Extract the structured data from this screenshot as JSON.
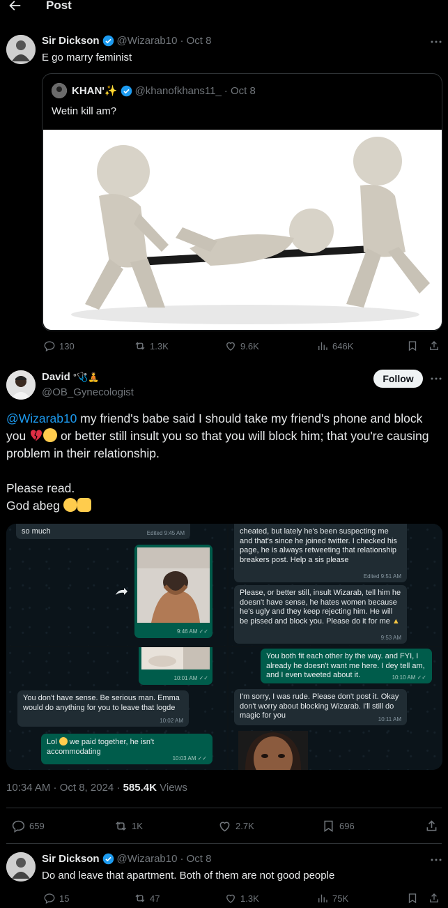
{
  "header": {
    "title": "Post"
  },
  "original_post": {
    "author_name": "Sir Dickson",
    "handle": "@Wizarab10",
    "date": "· Oct 8",
    "text": "E go marry feminist",
    "quote": {
      "author_name": "KHAN'✨",
      "handle": "@khanofkhans11_",
      "date": "· Oct 8",
      "text": "Wetin kill am?"
    },
    "stats": {
      "replies": "130",
      "reposts": "1.3K",
      "likes": "9.6K",
      "views": "646K"
    }
  },
  "main_post": {
    "author_name": "David",
    "author_emoji": "°🩺🧘",
    "handle": "@OB_Gynecologist",
    "follow_label": "Follow",
    "mention": "@Wizarab10",
    "text_part1": " my friend's babe said I should take my friend's phone and block you ",
    "text_part2": " or better still insult you so that you will block him; that you're causing problem in their relationship.",
    "line2": "Please read.",
    "line3": "God abeg",
    "timestamp": "10:34 AM · Oct 8, 2024 · ",
    "views_count": "585.4K",
    "views_label": " Views",
    "stats": {
      "replies": "659",
      "reposts": "1K",
      "likes": "2.7K",
      "bookmarks": "696"
    }
  },
  "chat": {
    "c1": {
      "text": "so much",
      "time": "Edited 9:45 AM"
    },
    "c2": {
      "time": "9:46 AM ✓✓"
    },
    "c3": {
      "text": "cheated, but lately he's been suspecting me and that's since he joined twitter. I checked his page, he is always retweeting that relationship breakers post. Help a sis please",
      "time": "Edited 9:51 AM"
    },
    "c4": {
      "text": "Please, or better still, insult Wizarab, tell him he doesn't have sense, he hates women because he's ugly and they keep rejecting him. He will be pissed and block you. Please do it for me",
      "time": "9:53 AM"
    },
    "c5": {
      "time": "10:01 AM ✓✓"
    },
    "c6": {
      "text": "You don't have sense. Be serious man. Emma would do anything for you to leave that logde",
      "time": "10:02 AM"
    },
    "c7": {
      "text_a": "Lol",
      "text_b": " we paid together, he isn't accommodating",
      "time": "10:03 AM ✓✓"
    },
    "c8": {
      "text": "You both fit each other by the way. and FYI, I already he doesn't want me here. I dey tell am, and I even tweeted about it.",
      "time": "10:10 AM ✓✓"
    },
    "c9": {
      "text": "I'm sorry, I was rude. Please don't post it. Okay don't worry about blocking Wizarab. I'll still do magic for you",
      "time": "10:11 AM"
    }
  },
  "reply_post": {
    "author_name": "Sir Dickson",
    "handle": "@Wizarab10",
    "date": "· Oct 8",
    "text": "Do and leave that apartment. Both of them are not good people",
    "stats": {
      "replies": "15",
      "reposts": "47",
      "likes": "1.3K",
      "views": "75K"
    }
  },
  "colors": {
    "accent": "#1d9bf0",
    "background": "#000000",
    "follow_bg": "#eff3f4"
  },
  "icons": [
    "back-arrow-icon",
    "verified-icon",
    "more-icon",
    "reply-icon",
    "repost-icon",
    "like-icon",
    "views-icon",
    "bookmark-icon",
    "share-icon",
    "forward-icon"
  ]
}
